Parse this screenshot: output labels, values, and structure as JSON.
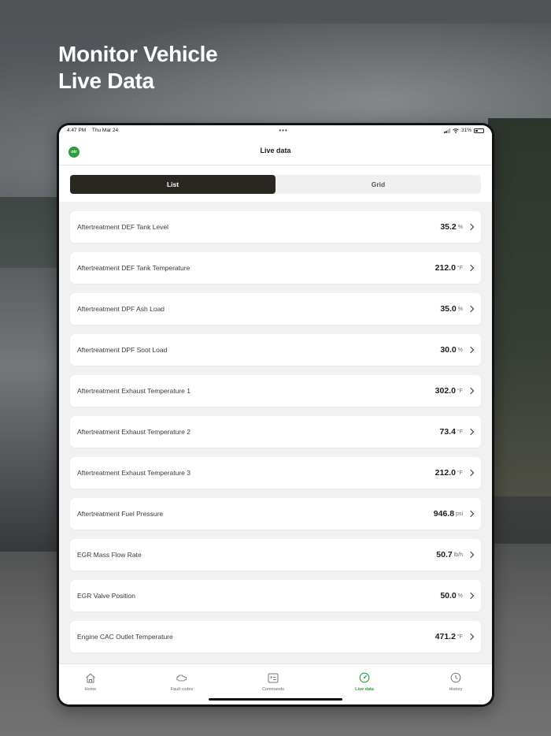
{
  "headline": {
    "line1": "Monitor Vehicle",
    "line2": "Live Data"
  },
  "status_bar": {
    "time": "4:47 PM",
    "date": "Thu Mar 24",
    "dots": "•••",
    "battery": "31%"
  },
  "nav": {
    "logo_text": "otr",
    "title": "Live data"
  },
  "segment": {
    "list_label": "List",
    "grid_label": "Grid",
    "selected": "List"
  },
  "rows": [
    {
      "label": "Aftertreatment DEF Tank Level",
      "value": "35.2",
      "unit": "%"
    },
    {
      "label": "Aftertreatment DEF Tank Temperature",
      "value": "212.0",
      "unit": "°F"
    },
    {
      "label": "Aftertreatment DPF Ash Load",
      "value": "35.0",
      "unit": "%"
    },
    {
      "label": "Aftertreatment DPF Soot Load",
      "value": "30.0",
      "unit": "%"
    },
    {
      "label": "Aftertreatment Exhaust Temperature 1",
      "value": "302.0",
      "unit": "°F"
    },
    {
      "label": "Aftertreatment Exhaust Temperature 2",
      "value": "73.4",
      "unit": "°F"
    },
    {
      "label": "Aftertreatment Exhaust Temperature 3",
      "value": "212.0",
      "unit": "°F"
    },
    {
      "label": "Aftertreatment Fuel Pressure",
      "value": "946.8",
      "unit": "psi"
    },
    {
      "label": "EGR Mass Flow Rate",
      "value": "50.7",
      "unit": "lb/h"
    },
    {
      "label": "EGR Valve Position",
      "value": "50.0",
      "unit": "%"
    },
    {
      "label": "Engine CAC Outlet Temperature",
      "value": "471.2",
      "unit": "°F"
    }
  ],
  "tabs": [
    {
      "label": "Home",
      "icon": "home-icon"
    },
    {
      "label": "Fault codes",
      "icon": "engine-icon"
    },
    {
      "label": "Commands",
      "icon": "commands-icon"
    },
    {
      "label": "Live data",
      "icon": "gauge-icon",
      "active": true
    },
    {
      "label": "History",
      "icon": "clock-icon"
    }
  ],
  "colors": {
    "accent": "#2f9e3f",
    "segment_active": "#2a2622"
  }
}
